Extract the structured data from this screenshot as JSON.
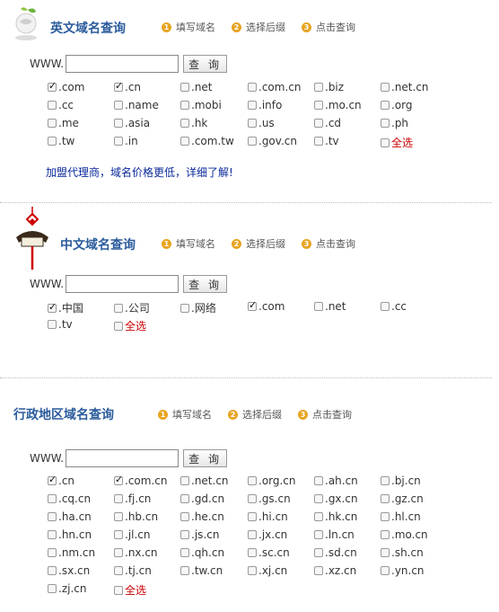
{
  "steps": [
    {
      "num": "1",
      "label": "填写域名"
    },
    {
      "num": "2",
      "label": "选择后缀"
    },
    {
      "num": "3",
      "label": "点击查询"
    }
  ],
  "search": {
    "prefix": "WWW.",
    "button": "查 询",
    "value": ""
  },
  "select_all_label": "全选",
  "english": {
    "title": "英文域名查询",
    "suffixes": [
      {
        "label": ".com",
        "checked": true
      },
      {
        "label": ".cn",
        "checked": true
      },
      {
        "label": ".net",
        "checked": false
      },
      {
        "label": ".com.cn",
        "checked": false
      },
      {
        "label": ".biz",
        "checked": false
      },
      {
        "label": ".net.cn",
        "checked": false
      },
      {
        "label": ".cc",
        "checked": false
      },
      {
        "label": ".name",
        "checked": false
      },
      {
        "label": ".mobi",
        "checked": false
      },
      {
        "label": ".info",
        "checked": false
      },
      {
        "label": ".mo.cn",
        "checked": false
      },
      {
        "label": ".org",
        "checked": false
      },
      {
        "label": ".me",
        "checked": false
      },
      {
        "label": ".asia",
        "checked": false
      },
      {
        "label": ".hk",
        "checked": false
      },
      {
        "label": ".us",
        "checked": false
      },
      {
        "label": ".cd",
        "checked": false
      },
      {
        "label": ".ph",
        "checked": false
      },
      {
        "label": ".tw",
        "checked": false
      },
      {
        "label": ".in",
        "checked": false
      },
      {
        "label": ".com.tw",
        "checked": false
      },
      {
        "label": ".gov.cn",
        "checked": false
      },
      {
        "label": ".tv",
        "checked": false
      }
    ],
    "agent_link": "加盟代理商，域名价格更低，详细了解!"
  },
  "chinese": {
    "title": "中文域名查询",
    "suffixes": [
      {
        "label": ".中国",
        "checked": true
      },
      {
        "label": ".公司",
        "checked": false
      },
      {
        "label": ".网络",
        "checked": false
      },
      {
        "label": ".com",
        "checked": true
      },
      {
        "label": ".net",
        "checked": false
      },
      {
        "label": ".cc",
        "checked": false
      },
      {
        "label": ".tv",
        "checked": false
      }
    ]
  },
  "regional": {
    "title": "行政地区域名查询",
    "suffixes": [
      {
        "label": ".cn",
        "checked": true
      },
      {
        "label": ".com.cn",
        "checked": true
      },
      {
        "label": ".net.cn",
        "checked": false
      },
      {
        "label": ".org.cn",
        "checked": false
      },
      {
        "label": ".ah.cn",
        "checked": false
      },
      {
        "label": ".bj.cn",
        "checked": false
      },
      {
        "label": ".cq.cn",
        "checked": false
      },
      {
        "label": ".fj.cn",
        "checked": false
      },
      {
        "label": ".gd.cn",
        "checked": false
      },
      {
        "label": ".gs.cn",
        "checked": false
      },
      {
        "label": ".gx.cn",
        "checked": false
      },
      {
        "label": ".gz.cn",
        "checked": false
      },
      {
        "label": ".ha.cn",
        "checked": false
      },
      {
        "label": ".hb.cn",
        "checked": false
      },
      {
        "label": ".he.cn",
        "checked": false
      },
      {
        "label": ".hi.cn",
        "checked": false
      },
      {
        "label": ".hk.cn",
        "checked": false
      },
      {
        "label": ".hl.cn",
        "checked": false
      },
      {
        "label": ".hn.cn",
        "checked": false
      },
      {
        "label": ".jl.cn",
        "checked": false
      },
      {
        "label": ".js.cn",
        "checked": false
      },
      {
        "label": ".jx.cn",
        "checked": false
      },
      {
        "label": ".ln.cn",
        "checked": false
      },
      {
        "label": ".mo.cn",
        "checked": false
      },
      {
        "label": ".nm.cn",
        "checked": false
      },
      {
        "label": ".nx.cn",
        "checked": false
      },
      {
        "label": ".qh.cn",
        "checked": false
      },
      {
        "label": ".sc.cn",
        "checked": false
      },
      {
        "label": ".sd.cn",
        "checked": false
      },
      {
        "label": ".sh.cn",
        "checked": false
      },
      {
        "label": ".sx.cn",
        "checked": false
      },
      {
        "label": ".tj.cn",
        "checked": false
      },
      {
        "label": ".tw.cn",
        "checked": false
      },
      {
        "label": ".xj.cn",
        "checked": false
      },
      {
        "label": ".xz.cn",
        "checked": false
      },
      {
        "label": ".yn.cn",
        "checked": false
      },
      {
        "label": ".zj.cn",
        "checked": false
      }
    ]
  },
  "colors": {
    "title": "#2a5b9c",
    "step_badge": "#e8a420",
    "select_all": "#cc0000",
    "agent_link": "#0a2a9a"
  }
}
